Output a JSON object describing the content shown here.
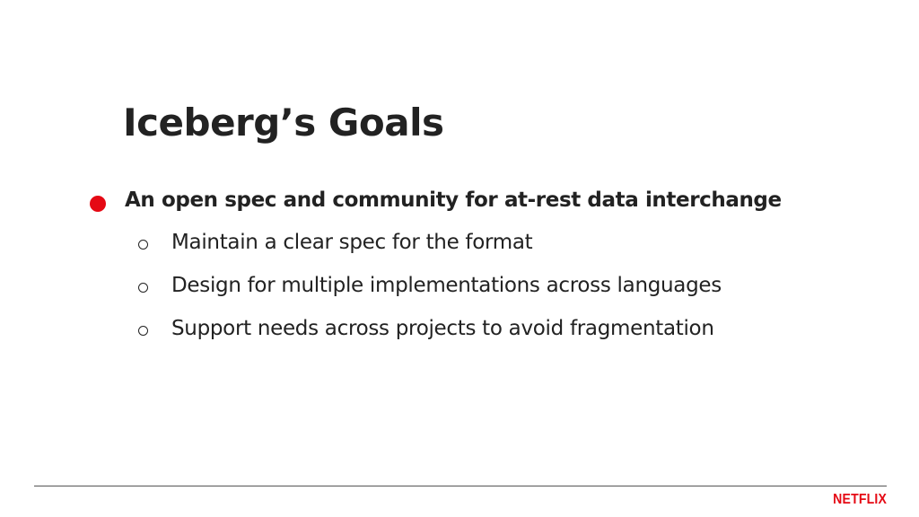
{
  "slide": {
    "title": "Iceberg’s Goals",
    "main_bullet": "An open spec and community for at-rest data interchange",
    "sub_bullets": [
      "Maintain a clear spec for the format",
      "Design for multiple implementations across languages",
      "Support needs across projects to avoid fragmentation"
    ]
  },
  "footer": {
    "logo_text": "NETFLIX"
  },
  "colors": {
    "accent": "#e50914",
    "text": "#222222",
    "background": "#ffffff"
  },
  "icons": {
    "main_bullet": "filled-circle-icon",
    "sub_bullet": "hollow-circle-icon"
  }
}
